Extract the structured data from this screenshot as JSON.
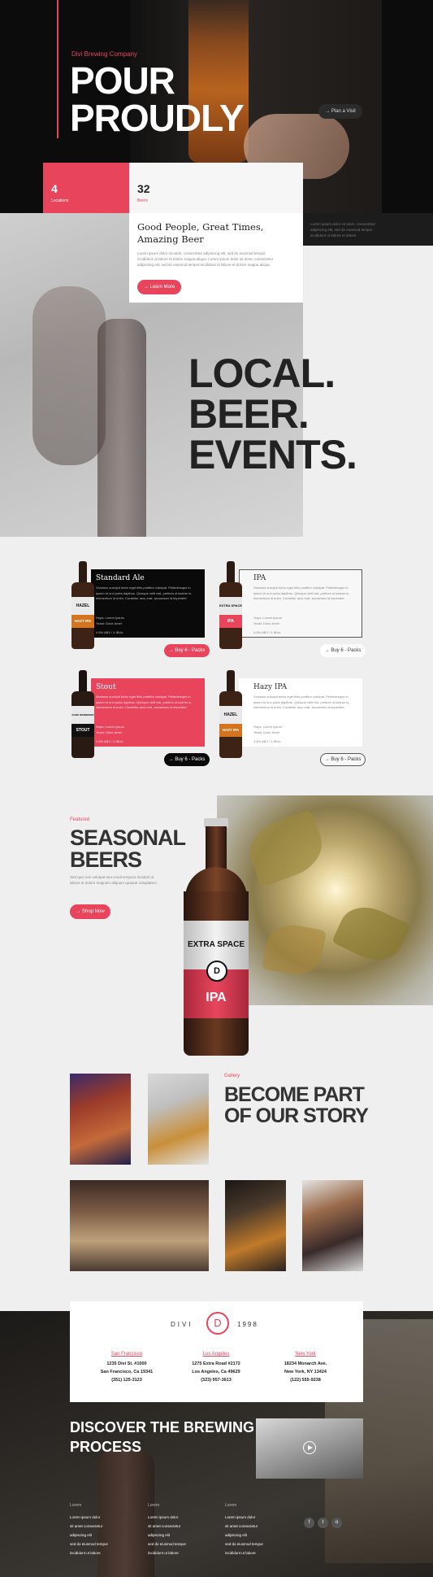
{
  "colors": {
    "accent": "#e8455d",
    "dark": "#111111",
    "light": "#efefef"
  },
  "hero": {
    "eyebrow": "Divi Brewing Company",
    "title_line1": "POUR",
    "title_line2": "PROUDLY",
    "plan_button": "→ Plan a Visit",
    "side_text": "Lorem ipsum dolor sit amet, consectetur adipiscing elit, sed do eiusmod tempor incididunt ut labore et dolore"
  },
  "stats": [
    {
      "number": "4",
      "label": "Locations"
    },
    {
      "number": "32",
      "label": "Beers"
    }
  ],
  "about": {
    "heading": "Good People, Great Times, Amazing Beer",
    "body": "Lorem ipsum dolor sit amet, consectetur adipiscing elit, sed do eiusmod tempor incididunt ut labore et dolore magna aliqua. Lorem ipsum dolor sit amet, consectetur adipiscing elit, sed do eiusmod tempor incididunt ut labore et dolore magna aliqua.",
    "button": "→ Learn More"
  },
  "big_title": {
    "line1": "LOCAL.",
    "line2": "BEER.",
    "line3": "EVENTS."
  },
  "beers": [
    {
      "name": "Standard Ale",
      "label_top": "HAZEL",
      "label_bottom": "HAZY IPA",
      "desc": "Vivamus suscipit tortor eget felis porttitor volutpat. Pellentesque in ipsum id orci porta dapibus. Quisque velit nisi, pretium ut lacinia in, elementum id enim. Curabitur arcu erat, accumsan id imperdiet",
      "hops": "Hops: Lorem Ipsum",
      "yeast": "Yeast: Dolor Amet",
      "abv": "4.6% ABV / 4 IBUs",
      "button": "→ Buy 6 - Packs"
    },
    {
      "name": "IPA",
      "label_top": "EXTRA SPACE",
      "label_bottom": "IPA",
      "desc": "Vivamus suscipit tortor eget felis porttitor volutpat. Pellentesque in ipsum id orci porta dapibus. Quisque velit nisi, pretium ut lacinia in, elementum id enim. Curabitur arcu erat, accumsan id imperdiet",
      "hops": "Hops: Lorem Ipsum",
      "yeast": "Yeast: Dolor Amet",
      "abv": "4.6% ABV / 4 IBUs",
      "button": "→ Buy 6 - Packs"
    },
    {
      "name": "Stout",
      "label_top": "DARK WANDERER",
      "label_bottom": "STOUT",
      "desc": "Vivamus suscipit tortor eget felis porttitor volutpat. Pellentesque in ipsum id orci porta dapibus. Quisque velit nisi, pretium ut lacinia in, elementum id enim. Curabitur arcu erat, accumsan id imperdiet",
      "hops": "Hops: Lorem Ipsum",
      "yeast": "Yeast: Dolor Amet",
      "abv": "4.6% ABV / 4 IBUs",
      "button": "→ Buy 6 - Packs"
    },
    {
      "name": "Hazy IPA",
      "label_top": "HAZEL",
      "label_bottom": "HAZY IPA",
      "desc": "Vivamus suscipit tortor eget felis porttitor volutpat. Pellentesque in ipsum id orci porta dapibus. Quisque velit nisi, pretium ut lacinia in, elementum id enim. Curabitur arcu erat, accumsan id imperdiet",
      "hops": "Hops: Lorem Ipsum",
      "yeast": "Yeast: Dolor Amet",
      "abv": "4.6% ABV / 4 IBUs",
      "button": "→ Buy 6 - Packs"
    }
  ],
  "seasonal": {
    "eyebrow": "Featured",
    "title_line1": "SEASONAL",
    "title_line2": "BEERS",
    "body": "Sed quis non volutpat eius modi tempora incidunt ut labore et dolore magnam aliquam quaerat voluptatem.",
    "button": "→ Shop Now",
    "bottle_top": "EXTRA SPACE",
    "bottle_logo": "D",
    "bottle_bottom": "IPA"
  },
  "gallery": {
    "eyebrow": "Gallery",
    "title_line1": "BECOME PART",
    "title_line2": "OF OUR STORY"
  },
  "locations": {
    "brand_left": "DIVI",
    "brand_logo": "D",
    "brand_right": "1998",
    "items": [
      {
        "city": "San Francisco",
        "street": "1235 Divi St. #1000",
        "region": "San Francisco, Ca 19341",
        "phone": "(351) 125-3123"
      },
      {
        "city": "Los Angeles",
        "street": "1275 Extra Road #2172",
        "region": "Los Angeles, Ca 49629",
        "phone": "(323) 957-3613"
      },
      {
        "city": "New York",
        "street": "18234 Monarch Ave.",
        "region": "New York, NY 13424",
        "phone": "(122) 555-9238"
      }
    ]
  },
  "footer": {
    "title_line1": "DISCOVER THE BREWING",
    "title_line2": "PROCESS",
    "columns": [
      {
        "heading": "Lorem",
        "links": [
          "Lorem ipsum dolor",
          "sit amet consectetur",
          "adipiscing elit",
          "sed do eiusmod tempor",
          "incididunt ut labore"
        ]
      },
      {
        "heading": "Lorem",
        "links": [
          "Lorem ipsum dolor",
          "sit amet consectetur",
          "adipiscing elit",
          "sed do eiusmod tempor",
          "incididunt ut labore"
        ]
      },
      {
        "heading": "Lorem",
        "links": [
          "Lorem ipsum dolor",
          "sit amet consectetur",
          "adipiscing elit",
          "sed do eiusmod tempor",
          "incididunt ut labore"
        ]
      }
    ],
    "social": [
      "f",
      "t",
      "o"
    ]
  }
}
